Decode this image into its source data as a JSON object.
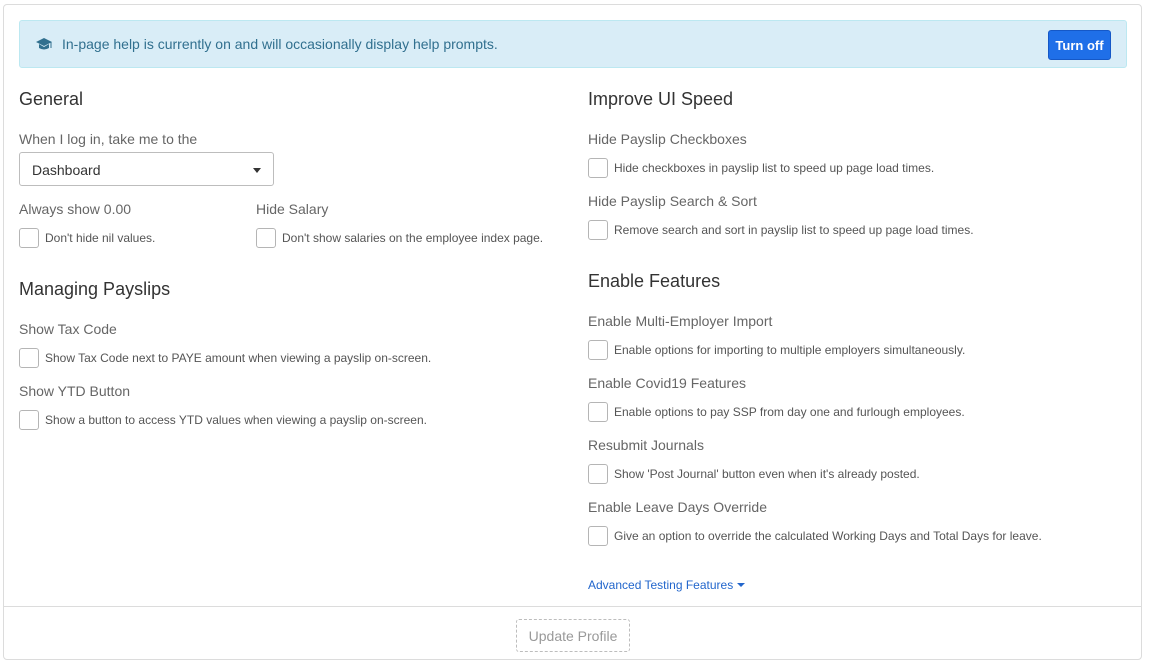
{
  "help_banner": {
    "icon": "graduation-cap-icon",
    "text": "In-page help is currently on and will occasionally display help prompts.",
    "button": "Turn off"
  },
  "general": {
    "title": "General",
    "landing_label": "When I log in, take me to the",
    "landing_value": "Dashboard",
    "always_show": {
      "label": "Always show 0.00",
      "checkbox": "Don't hide nil values."
    },
    "hide_salary": {
      "label": "Hide Salary",
      "checkbox": "Don't show salaries on the employee index page."
    }
  },
  "managing": {
    "title": "Managing Payslips",
    "tax_code": {
      "label": "Show Tax Code",
      "checkbox": "Show Tax Code next to PAYE amount when viewing a payslip on-screen."
    },
    "ytd": {
      "label": "Show YTD Button",
      "checkbox": "Show a button to access YTD values when viewing a payslip on-screen."
    }
  },
  "speed": {
    "title": "Improve UI Speed",
    "checkboxes": {
      "label": "Hide Payslip Checkboxes",
      "checkbox": "Hide checkboxes in payslip list to speed up page load times."
    },
    "search_sort": {
      "label": "Hide Payslip Search & Sort",
      "checkbox": "Remove search and sort in payslip list to speed up page load times."
    }
  },
  "features": {
    "title": "Enable Features",
    "multi_employer": {
      "label": "Enable Multi-Employer Import",
      "checkbox": "Enable options for importing to multiple employers simultaneously."
    },
    "covid": {
      "label": "Enable Covid19 Features",
      "checkbox": "Enable options to pay SSP from day one and furlough employees."
    },
    "resubmit": {
      "label": "Resubmit Journals",
      "checkbox": "Show 'Post Journal' button even when it's already posted."
    },
    "leave": {
      "label": "Enable Leave Days Override",
      "checkbox": "Give an option to override the calculated Working Days and Total Days for leave."
    }
  },
  "advanced_link": "Advanced Testing Features",
  "update_button": "Update Profile",
  "colors": {
    "banner_bg": "#d9edf7",
    "banner_text": "#31708f",
    "primary": "#1f6fe8",
    "link": "#2266cc"
  }
}
